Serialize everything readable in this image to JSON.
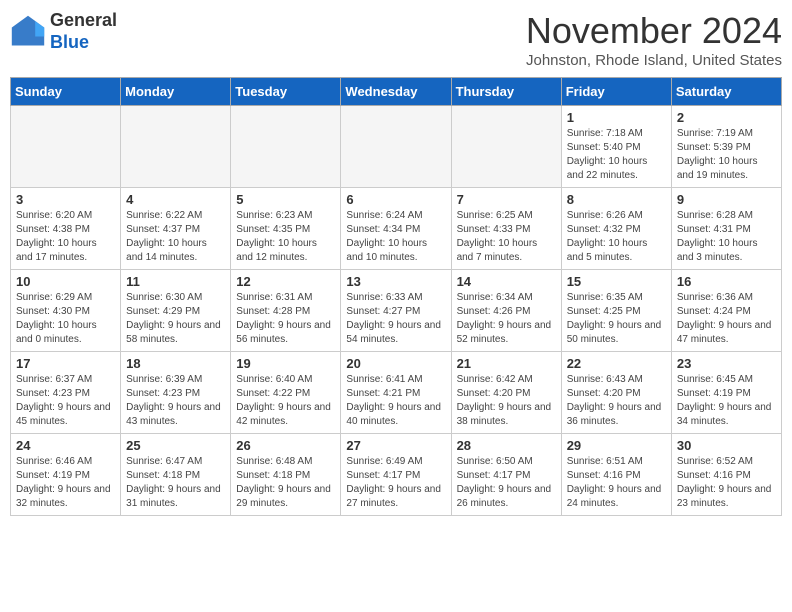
{
  "logo": {
    "general": "General",
    "blue": "Blue"
  },
  "header": {
    "month": "November 2024",
    "location": "Johnston, Rhode Island, United States"
  },
  "weekdays": [
    "Sunday",
    "Monday",
    "Tuesday",
    "Wednesday",
    "Thursday",
    "Friday",
    "Saturday"
  ],
  "weeks": [
    [
      {
        "day": "",
        "info": ""
      },
      {
        "day": "",
        "info": ""
      },
      {
        "day": "",
        "info": ""
      },
      {
        "day": "",
        "info": ""
      },
      {
        "day": "",
        "info": ""
      },
      {
        "day": "1",
        "info": "Sunrise: 7:18 AM\nSunset: 5:40 PM\nDaylight: 10 hours and 22 minutes."
      },
      {
        "day": "2",
        "info": "Sunrise: 7:19 AM\nSunset: 5:39 PM\nDaylight: 10 hours and 19 minutes."
      }
    ],
    [
      {
        "day": "3",
        "info": "Sunrise: 6:20 AM\nSunset: 4:38 PM\nDaylight: 10 hours and 17 minutes."
      },
      {
        "day": "4",
        "info": "Sunrise: 6:22 AM\nSunset: 4:37 PM\nDaylight: 10 hours and 14 minutes."
      },
      {
        "day": "5",
        "info": "Sunrise: 6:23 AM\nSunset: 4:35 PM\nDaylight: 10 hours and 12 minutes."
      },
      {
        "day": "6",
        "info": "Sunrise: 6:24 AM\nSunset: 4:34 PM\nDaylight: 10 hours and 10 minutes."
      },
      {
        "day": "7",
        "info": "Sunrise: 6:25 AM\nSunset: 4:33 PM\nDaylight: 10 hours and 7 minutes."
      },
      {
        "day": "8",
        "info": "Sunrise: 6:26 AM\nSunset: 4:32 PM\nDaylight: 10 hours and 5 minutes."
      },
      {
        "day": "9",
        "info": "Sunrise: 6:28 AM\nSunset: 4:31 PM\nDaylight: 10 hours and 3 minutes."
      }
    ],
    [
      {
        "day": "10",
        "info": "Sunrise: 6:29 AM\nSunset: 4:30 PM\nDaylight: 10 hours and 0 minutes."
      },
      {
        "day": "11",
        "info": "Sunrise: 6:30 AM\nSunset: 4:29 PM\nDaylight: 9 hours and 58 minutes."
      },
      {
        "day": "12",
        "info": "Sunrise: 6:31 AM\nSunset: 4:28 PM\nDaylight: 9 hours and 56 minutes."
      },
      {
        "day": "13",
        "info": "Sunrise: 6:33 AM\nSunset: 4:27 PM\nDaylight: 9 hours and 54 minutes."
      },
      {
        "day": "14",
        "info": "Sunrise: 6:34 AM\nSunset: 4:26 PM\nDaylight: 9 hours and 52 minutes."
      },
      {
        "day": "15",
        "info": "Sunrise: 6:35 AM\nSunset: 4:25 PM\nDaylight: 9 hours and 50 minutes."
      },
      {
        "day": "16",
        "info": "Sunrise: 6:36 AM\nSunset: 4:24 PM\nDaylight: 9 hours and 47 minutes."
      }
    ],
    [
      {
        "day": "17",
        "info": "Sunrise: 6:37 AM\nSunset: 4:23 PM\nDaylight: 9 hours and 45 minutes."
      },
      {
        "day": "18",
        "info": "Sunrise: 6:39 AM\nSunset: 4:23 PM\nDaylight: 9 hours and 43 minutes."
      },
      {
        "day": "19",
        "info": "Sunrise: 6:40 AM\nSunset: 4:22 PM\nDaylight: 9 hours and 42 minutes."
      },
      {
        "day": "20",
        "info": "Sunrise: 6:41 AM\nSunset: 4:21 PM\nDaylight: 9 hours and 40 minutes."
      },
      {
        "day": "21",
        "info": "Sunrise: 6:42 AM\nSunset: 4:20 PM\nDaylight: 9 hours and 38 minutes."
      },
      {
        "day": "22",
        "info": "Sunrise: 6:43 AM\nSunset: 4:20 PM\nDaylight: 9 hours and 36 minutes."
      },
      {
        "day": "23",
        "info": "Sunrise: 6:45 AM\nSunset: 4:19 PM\nDaylight: 9 hours and 34 minutes."
      }
    ],
    [
      {
        "day": "24",
        "info": "Sunrise: 6:46 AM\nSunset: 4:19 PM\nDaylight: 9 hours and 32 minutes."
      },
      {
        "day": "25",
        "info": "Sunrise: 6:47 AM\nSunset: 4:18 PM\nDaylight: 9 hours and 31 minutes."
      },
      {
        "day": "26",
        "info": "Sunrise: 6:48 AM\nSunset: 4:18 PM\nDaylight: 9 hours and 29 minutes."
      },
      {
        "day": "27",
        "info": "Sunrise: 6:49 AM\nSunset: 4:17 PM\nDaylight: 9 hours and 27 minutes."
      },
      {
        "day": "28",
        "info": "Sunrise: 6:50 AM\nSunset: 4:17 PM\nDaylight: 9 hours and 26 minutes."
      },
      {
        "day": "29",
        "info": "Sunrise: 6:51 AM\nSunset: 4:16 PM\nDaylight: 9 hours and 24 minutes."
      },
      {
        "day": "30",
        "info": "Sunrise: 6:52 AM\nSunset: 4:16 PM\nDaylight: 9 hours and 23 minutes."
      }
    ]
  ]
}
